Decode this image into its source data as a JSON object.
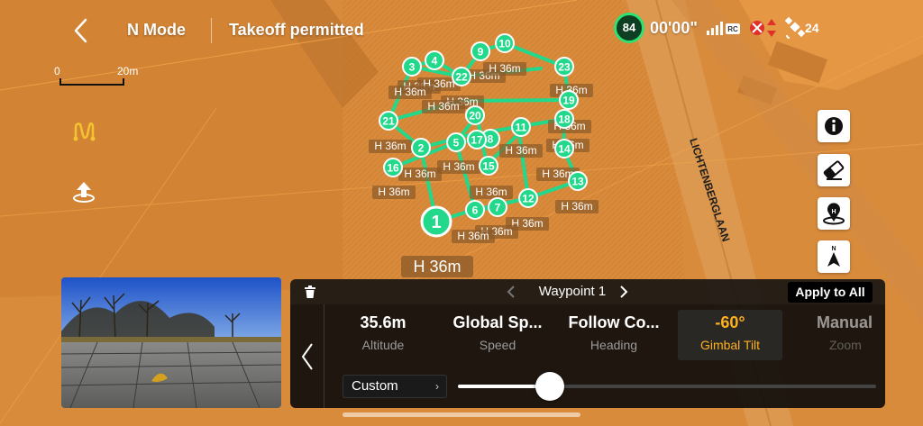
{
  "top_bar": {
    "mode": "N Mode",
    "takeoff_status": "Takeoff permitted",
    "battery_percent": "84",
    "flight_time": "00'00\"",
    "signal_label": "RC",
    "satellite_count": "24"
  },
  "scale": {
    "start": "0",
    "end": "20m"
  },
  "map": {
    "street_name": "LICHTENBERGLAAN",
    "home_height": "H 36m",
    "waypoints": [
      "1",
      "2",
      "3",
      "4",
      "5",
      "6",
      "7",
      "8",
      "9",
      "10",
      "11",
      "12",
      "13",
      "14",
      "15",
      "16",
      "17",
      "18",
      "19",
      "20",
      "21",
      "22",
      "23"
    ],
    "height_label": "H 36m"
  },
  "icons": {
    "back": "chevron-left-icon",
    "route_tool": "route-icon",
    "takeoff_point": "takeoff-point-icon",
    "info": "info-icon",
    "eraser": "eraser-icon",
    "home_location": "home-location-icon",
    "north": "north-arrow-icon",
    "trash": "trash-icon"
  },
  "panel": {
    "waypoint_title": "Waypoint 1",
    "apply_all": "Apply to All",
    "params": [
      {
        "value": "35.6m",
        "label": "Altitude"
      },
      {
        "value": "Global Sp...",
        "label": "Speed"
      },
      {
        "value": "Follow Co...",
        "label": "Heading"
      },
      {
        "value": "-60°",
        "label": "Gimbal Tilt"
      },
      {
        "value": "Manual",
        "label": "Zoom"
      }
    ],
    "custom_label": "Custom",
    "slider_fraction": 0.22
  },
  "colors": {
    "map_tint": "#e0923a",
    "route": "#22d88a",
    "active_param": "#ffb020",
    "battery_ring": "#2fe072"
  }
}
